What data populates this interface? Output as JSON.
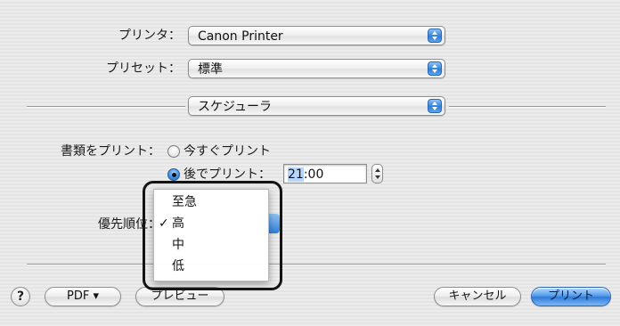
{
  "printer": {
    "label": "プリンタ：",
    "value": "Canon Printer"
  },
  "preset": {
    "label": "プリセット：",
    "value": "標準"
  },
  "panel": {
    "value": "スケジューラ"
  },
  "print_documents": {
    "label": "書類をプリント：",
    "option_now": "今すぐプリント",
    "option_later": "後でプリント：",
    "selected": "option_later",
    "time_hour": "21",
    "time_rest": ":00"
  },
  "priority": {
    "label": "優先順位：",
    "options": [
      "至急",
      "高",
      "中",
      "低"
    ],
    "selected": "高",
    "check_mark": "✓"
  },
  "buttons": {
    "help": "?",
    "pdf": "PDF ▾",
    "preview": "プレビュー",
    "cancel": "キャンセル",
    "print": "プリント"
  },
  "colors": {
    "accent": "#2f7fd8",
    "highlight_frame": "#141414"
  }
}
